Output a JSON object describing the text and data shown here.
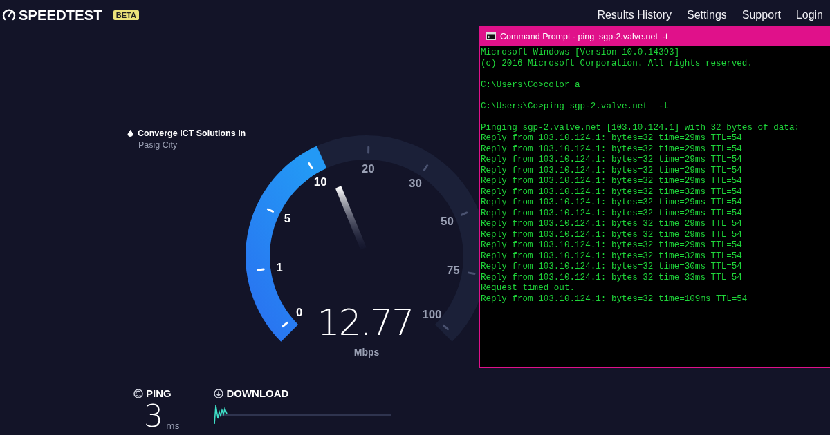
{
  "header": {
    "logo": "SPEEDTEST",
    "badge": "BETA",
    "nav": [
      "Results History",
      "Settings",
      "Support",
      "Login"
    ]
  },
  "server": {
    "isp": "Converge ICT Solutions In",
    "location": "Pasig City"
  },
  "gauge": {
    "labels": [
      "0",
      "1",
      "5",
      "10",
      "20",
      "30",
      "50",
      "75",
      "100"
    ],
    "level": 0.41,
    "value": "12.77",
    "unit": "Mbps"
  },
  "stats": [
    {
      "kind": "ping",
      "label": "PING",
      "value": "3",
      "unit": "ms"
    },
    {
      "kind": "download",
      "label": "DOWNLOAD"
    }
  ],
  "terminal": {
    "title": "Command Prompt - ping  sgp-2.valve.net  -t",
    "blocks": [
      [
        "Microsoft Windows [Version 10.0.14393]",
        "(c) 2016 Microsoft Corporation. All rights reserved."
      ],
      [
        "C:\\Users\\Co>color a"
      ],
      [
        "C:\\Users\\Co>ping sgp-2.valve.net  -t"
      ],
      [
        "Pinging sgp-2.valve.net [103.10.124.1] with 32 bytes of data:",
        "Reply from 103.10.124.1: bytes=32 time=29ms TTL=54",
        "Reply from 103.10.124.1: bytes=32 time=29ms TTL=54",
        "Reply from 103.10.124.1: bytes=32 time=29ms TTL=54",
        "Reply from 103.10.124.1: bytes=32 time=29ms TTL=54",
        "Reply from 103.10.124.1: bytes=32 time=29ms TTL=54",
        "Reply from 103.10.124.1: bytes=32 time=32ms TTL=54",
        "Reply from 103.10.124.1: bytes=32 time=29ms TTL=54",
        "Reply from 103.10.124.1: bytes=32 time=29ms TTL=54",
        "Reply from 103.10.124.1: bytes=32 time=29ms TTL=54",
        "Reply from 103.10.124.1: bytes=32 time=29ms TTL=54",
        "Reply from 103.10.124.1: bytes=32 time=29ms TTL=54",
        "Reply from 103.10.124.1: bytes=32 time=32ms TTL=54",
        "Reply from 103.10.124.1: bytes=32 time=30ms TTL=54",
        "Reply from 103.10.124.1: bytes=32 time=33ms TTL=54",
        "Request timed out.",
        "Reply from 103.10.124.1: bytes=32 time=109ms TTL=54"
      ]
    ]
  }
}
